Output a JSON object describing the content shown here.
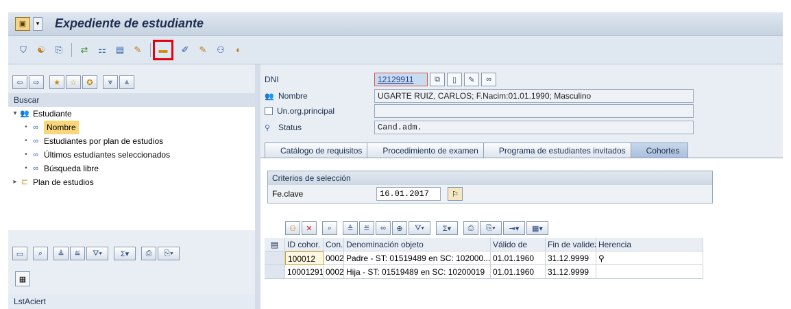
{
  "window": {
    "title": "Expediente de estudiante"
  },
  "toolbar": {
    "icons": [
      "app-icon-1",
      "app-icon-2",
      "app-icon-3",
      "app-icon-4",
      "app-icon-5",
      "app-icon-6",
      "app-icon-7",
      "open-folder-icon",
      "app-icon-9",
      "app-icon-10",
      "app-icon-11",
      "app-icon-12"
    ],
    "highlight_color": "#e3000f"
  },
  "left": {
    "search_label": "Buscar",
    "tree": [
      {
        "label": "Estudiante",
        "icon": "people-icon"
      },
      {
        "label": "Nombre",
        "icon": "binoculars-icon",
        "selected": true
      },
      {
        "label": "Estudiantes por plan de estudios",
        "icon": "binoculars-icon"
      },
      {
        "label": "Últimos estudiantes seleccionados",
        "icon": "binoculars-icon"
      },
      {
        "label": "Búsqueda libre",
        "icon": "binoculars-icon"
      },
      {
        "label": "Plan de estudios",
        "icon": "hierarchy-icon"
      }
    ],
    "list_label": "LstAciert"
  },
  "form": {
    "dni_label": "DNI",
    "dni_value": "12129911",
    "nombre_label": "Nombre",
    "nombre_value": "UGARTE RUIZ, CARLOS; F.Nacim:01.01.1990; Masculino",
    "unorg_label": "Un.org.principal",
    "unorg_value": "",
    "status_label": "Status",
    "status_value": "Cand.adm."
  },
  "tabs": [
    "Catálogo de requisitos",
    "Procedimiento de examen",
    "Programa de estudiantes invitados",
    "Cohortes"
  ],
  "active_tab": "Cohortes",
  "criteria": {
    "title": "Criterios de selección",
    "fecha_label": "Fe.clave",
    "fecha_value": "16.01.2017"
  },
  "grid": {
    "headers": [
      "ID cohor.",
      "Con...",
      "Denominación objeto",
      "Válido de",
      "Fin de validez",
      "Herencia"
    ],
    "rows": [
      [
        "100012",
        "0002",
        "Padre - ST: 01519489 en SC: 102000...",
        "01.01.1960",
        "31.12.9999",
        "⚲"
      ],
      [
        "10001291",
        "0002",
        "Hija - ST: 01519489 en SC: 10200019",
        "01.01.1960",
        "31.12.9999",
        ""
      ]
    ]
  }
}
